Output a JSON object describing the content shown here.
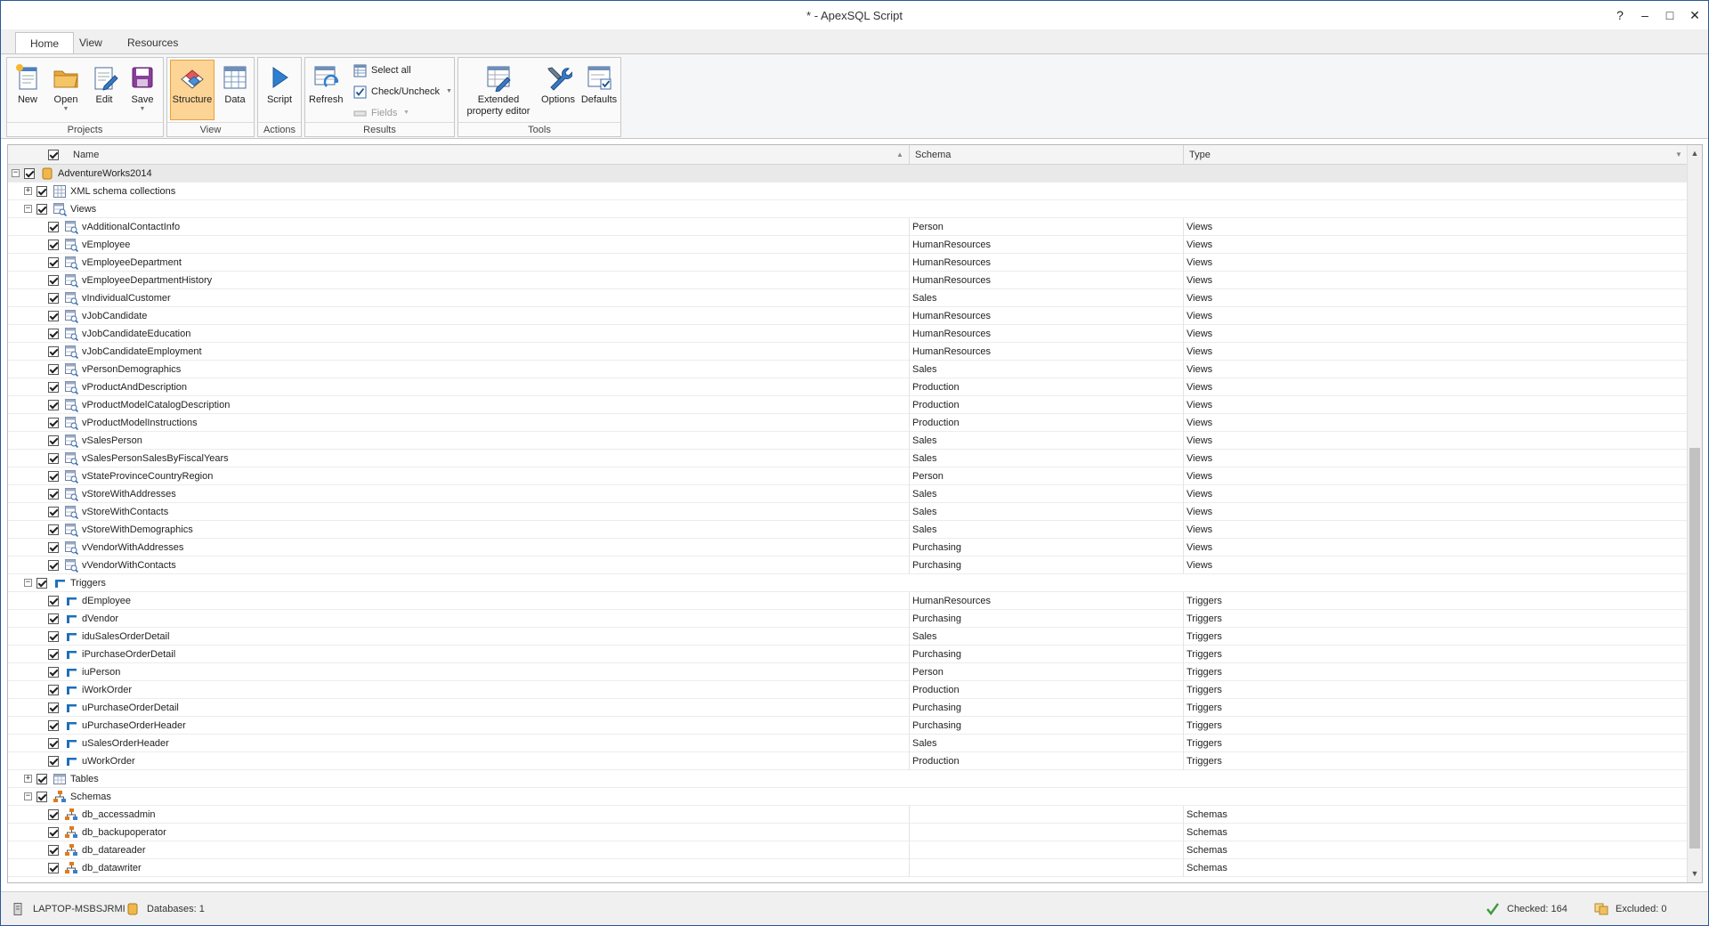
{
  "app": {
    "title": "* - ApexSQL Script",
    "help": "?",
    "minimize": "–",
    "maximize": "□",
    "close": "✕"
  },
  "ribbon_tabs": [
    {
      "label": "Home",
      "active": true
    },
    {
      "label": "View",
      "active": false
    },
    {
      "label": "Resources",
      "active": false
    }
  ],
  "ribbon": {
    "projects": {
      "caption": "Projects",
      "new": "New",
      "open": "Open",
      "edit": "Edit",
      "save": "Save"
    },
    "view": {
      "caption": "View",
      "structure": "Structure",
      "data": "Data"
    },
    "actions": {
      "caption": "Actions",
      "script": "Script"
    },
    "results": {
      "caption": "Results",
      "refresh": "Refresh",
      "select_all": "Select all",
      "check_uncheck": "Check/Uncheck",
      "fields": "Fields"
    },
    "tools": {
      "caption": "Tools",
      "extended_line1": "Extended",
      "extended_line2": "property editor",
      "options": "Options",
      "defaults": "Defaults"
    }
  },
  "grid": {
    "columns": {
      "name": "Name",
      "schema": "Schema",
      "type": "Type"
    },
    "rows": [
      {
        "level": 0,
        "toggle": "−",
        "icon": "database-icon",
        "name": "AdventureWorks2014",
        "schema": "",
        "type": "",
        "selected": true
      },
      {
        "level": 1,
        "toggle": "+",
        "icon": "xml-schema-icon",
        "name": "XML schema collections",
        "schema": "",
        "type": ""
      },
      {
        "level": 1,
        "toggle": "−",
        "icon": "view-icon",
        "name": "Views",
        "schema": "",
        "type": ""
      },
      {
        "level": 2,
        "icon": "view-icon",
        "name": "vAdditionalContactInfo",
        "schema": "Person",
        "type": "Views"
      },
      {
        "level": 2,
        "icon": "view-icon",
        "name": "vEmployee",
        "schema": "HumanResources",
        "type": "Views"
      },
      {
        "level": 2,
        "icon": "view-icon",
        "name": "vEmployeeDepartment",
        "schema": "HumanResources",
        "type": "Views"
      },
      {
        "level": 2,
        "icon": "view-icon",
        "name": "vEmployeeDepartmentHistory",
        "schema": "HumanResources",
        "type": "Views"
      },
      {
        "level": 2,
        "icon": "view-icon",
        "name": "vIndividualCustomer",
        "schema": "Sales",
        "type": "Views"
      },
      {
        "level": 2,
        "icon": "view-icon",
        "name": "vJobCandidate",
        "schema": "HumanResources",
        "type": "Views"
      },
      {
        "level": 2,
        "icon": "view-icon",
        "name": "vJobCandidateEducation",
        "schema": "HumanResources",
        "type": "Views"
      },
      {
        "level": 2,
        "icon": "view-icon",
        "name": "vJobCandidateEmployment",
        "schema": "HumanResources",
        "type": "Views"
      },
      {
        "level": 2,
        "icon": "view-icon",
        "name": "vPersonDemographics",
        "schema": "Sales",
        "type": "Views"
      },
      {
        "level": 2,
        "icon": "view-icon",
        "name": "vProductAndDescription",
        "schema": "Production",
        "type": "Views"
      },
      {
        "level": 2,
        "icon": "view-icon",
        "name": "vProductModelCatalogDescription",
        "schema": "Production",
        "type": "Views"
      },
      {
        "level": 2,
        "icon": "view-icon",
        "name": "vProductModelInstructions",
        "schema": "Production",
        "type": "Views"
      },
      {
        "level": 2,
        "icon": "view-icon",
        "name": "vSalesPerson",
        "schema": "Sales",
        "type": "Views"
      },
      {
        "level": 2,
        "icon": "view-icon",
        "name": "vSalesPersonSalesByFiscalYears",
        "schema": "Sales",
        "type": "Views"
      },
      {
        "level": 2,
        "icon": "view-icon",
        "name": "vStateProvinceCountryRegion",
        "schema": "Person",
        "type": "Views"
      },
      {
        "level": 2,
        "icon": "view-icon",
        "name": "vStoreWithAddresses",
        "schema": "Sales",
        "type": "Views"
      },
      {
        "level": 2,
        "icon": "view-icon",
        "name": "vStoreWithContacts",
        "schema": "Sales",
        "type": "Views"
      },
      {
        "level": 2,
        "icon": "view-icon",
        "name": "vStoreWithDemographics",
        "schema": "Sales",
        "type": "Views"
      },
      {
        "level": 2,
        "icon": "view-icon",
        "name": "vVendorWithAddresses",
        "schema": "Purchasing",
        "type": "Views"
      },
      {
        "level": 2,
        "icon": "view-icon",
        "name": "vVendorWithContacts",
        "schema": "Purchasing",
        "type": "Views"
      },
      {
        "level": 1,
        "toggle": "−",
        "icon": "trigger-icon",
        "name": "Triggers",
        "schema": "",
        "type": ""
      },
      {
        "level": 2,
        "icon": "trigger-icon",
        "name": "dEmployee",
        "schema": "HumanResources",
        "type": "Triggers"
      },
      {
        "level": 2,
        "icon": "trigger-icon",
        "name": "dVendor",
        "schema": "Purchasing",
        "type": "Triggers"
      },
      {
        "level": 2,
        "icon": "trigger-icon",
        "name": "iduSalesOrderDetail",
        "schema": "Sales",
        "type": "Triggers"
      },
      {
        "level": 2,
        "icon": "trigger-icon",
        "name": "iPurchaseOrderDetail",
        "schema": "Purchasing",
        "type": "Triggers"
      },
      {
        "level": 2,
        "icon": "trigger-icon",
        "name": "iuPerson",
        "schema": "Person",
        "type": "Triggers"
      },
      {
        "level": 2,
        "icon": "trigger-icon",
        "name": "iWorkOrder",
        "schema": "Production",
        "type": "Triggers"
      },
      {
        "level": 2,
        "icon": "trigger-icon",
        "name": "uPurchaseOrderDetail",
        "schema": "Purchasing",
        "type": "Triggers"
      },
      {
        "level": 2,
        "icon": "trigger-icon",
        "name": "uPurchaseOrderHeader",
        "schema": "Purchasing",
        "type": "Triggers"
      },
      {
        "level": 2,
        "icon": "trigger-icon",
        "name": "uSalesOrderHeader",
        "schema": "Sales",
        "type": "Triggers"
      },
      {
        "level": 2,
        "icon": "trigger-icon",
        "name": "uWorkOrder",
        "schema": "Production",
        "type": "Triggers"
      },
      {
        "level": 1,
        "toggle": "+",
        "icon": "table-icon",
        "name": "Tables",
        "schema": "",
        "type": ""
      },
      {
        "level": 1,
        "toggle": "−",
        "icon": "schema-icon",
        "name": "Schemas",
        "schema": "",
        "type": ""
      },
      {
        "level": 2,
        "icon": "schema-icon",
        "name": "db_accessadmin",
        "schema": "",
        "type": "Schemas"
      },
      {
        "level": 2,
        "icon": "schema-icon",
        "name": "db_backupoperator",
        "schema": "",
        "type": "Schemas"
      },
      {
        "level": 2,
        "icon": "schema-icon",
        "name": "db_datareader",
        "schema": "",
        "type": "Schemas"
      },
      {
        "level": 2,
        "icon": "schema-icon",
        "name": "db_datawriter",
        "schema": "",
        "type": "Schemas"
      }
    ]
  },
  "status": {
    "server": "LAPTOP-MSBSJRMI",
    "databases": "Databases: 1",
    "checked": "Checked: 164",
    "excluded": "Excluded: 0"
  },
  "colors": {
    "accent": "#2b579a",
    "selected_button": "#fcd495",
    "trigger_blue": "#1e6fb8",
    "schema_orange": "#e07a1f",
    "check_green": "#3c9a3c"
  }
}
